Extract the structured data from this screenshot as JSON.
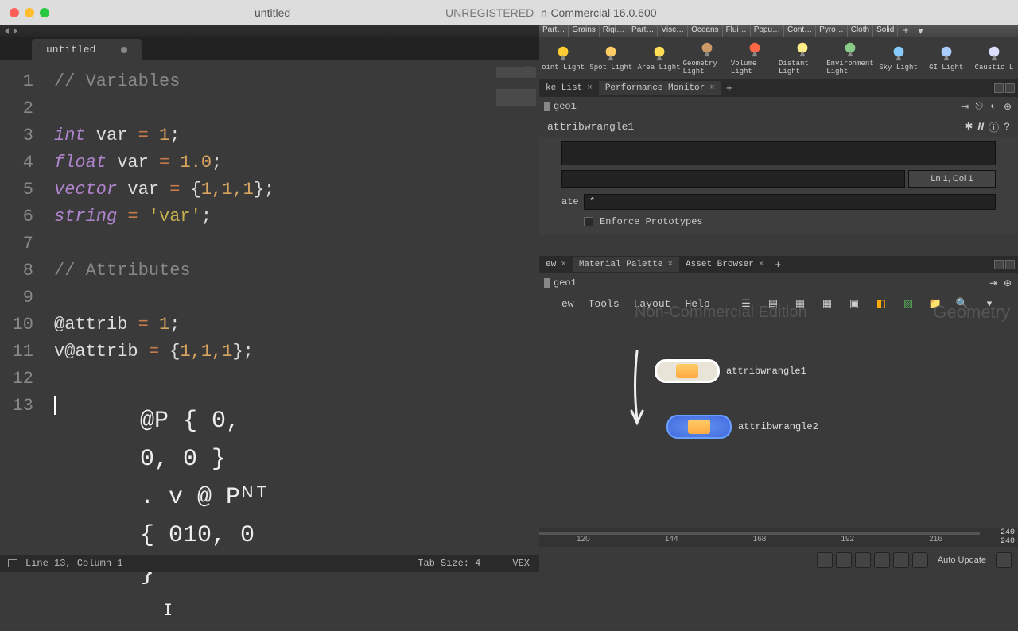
{
  "mac": {
    "title": "untitled",
    "reg": "UNREGISTERED",
    "houdini": "n-Commercial 16.0.600"
  },
  "tab": "untitled",
  "gutter": [
    "1",
    "2",
    "3",
    "4",
    "5",
    "6",
    "7",
    "8",
    "9",
    "10",
    "11",
    "12",
    "13"
  ],
  "code": {
    "l1_c": "// Variables",
    "l3_kw": "int",
    "l3_v": " var ",
    "l3_op": "= ",
    "l3_n": "1",
    "l3_e": ";",
    "l4_kw": "float",
    "l4_v": " var ",
    "l4_op": "= ",
    "l4_n": "1.0",
    "l4_e": ";",
    "l5_kw": "vector",
    "l5_v": " var ",
    "l5_op": "= ",
    "l5_b": "{",
    "l5_n": "1,1,1",
    "l5_b2": "};",
    "l6_kw": "string",
    "l6_op": " = ",
    "l6_s": "'var'",
    "l6_e": ";",
    "l8_c": "// Attributes",
    "l10_a": "@attrib ",
    "l10_op": "= ",
    "l10_n": "1",
    "l10_e": ";",
    "l11_a": "v@attrib ",
    "l11_op": "= ",
    "l11_b": "{",
    "l11_n": "1,1,1",
    "l11_b2": "};"
  },
  "handwrite": {
    "l1": "@P { 0, 0, 0 }",
    "l2": ". v @ Pᴺᵀ { 010, 0 }"
  },
  "status": {
    "pos": "Line 13, Column 1",
    "tab": "Tab Size: 4",
    "lang": "VEX"
  },
  "shelf": {
    "tabs": [
      "Part…",
      "Grains",
      "Rigi…",
      "Part…",
      "Visc…",
      "Oceans",
      "Flui…",
      "Popu…",
      "Cont…",
      "Pyro…",
      "Cloth",
      "Solid"
    ],
    "icons": [
      "oint Light",
      "Spot Light",
      "Area Light",
      "Geometry Light",
      "Volume Light",
      "Distant Light",
      "Environment Light",
      "Sky Light",
      "GI Light",
      "Caustic L"
    ]
  },
  "upperTabs": {
    "t1": "ke List",
    "t2": "Performance Monitor"
  },
  "path": {
    "geo": "geo1",
    "node": "attribwrangle1",
    "stat": "Ln 1, Col 1",
    "ate": "ate",
    "star": "*",
    "enforce": "Enforce Prototypes"
  },
  "lowerTabs": {
    "t1": "ew",
    "t2": "Material Palette",
    "t3": "Asset Browser"
  },
  "netMenu": {
    "m1": "ew",
    "m2": "Tools",
    "m3": "Layout",
    "m4": "Help"
  },
  "watermark": "Non-Commercial Edition",
  "geomLabel": "Geometry",
  "nodes": {
    "n1": "attribwrangle1",
    "n2": "attribwrangle2"
  },
  "timeline": {
    "ticks": [
      "120",
      "144",
      "168",
      "192",
      "216"
    ],
    "end1": "240",
    "end2": "240"
  },
  "autoUpdate": "Auto Update"
}
